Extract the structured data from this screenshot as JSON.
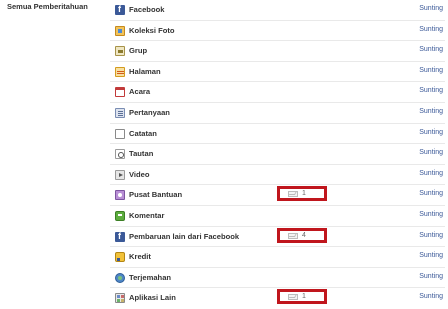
{
  "section_label": "Semua Pemberitahuan",
  "edit_label": "Sunting",
  "items": [
    {
      "label": "Facebook",
      "icon": "facebook-icon"
    },
    {
      "label": "Koleksi Foto",
      "icon": "photo-album-icon"
    },
    {
      "label": "Grup",
      "icon": "group-icon"
    },
    {
      "label": "Halaman",
      "icon": "page-flag-icon"
    },
    {
      "label": "Acara",
      "icon": "calendar-icon"
    },
    {
      "label": "Pertanyaan",
      "icon": "question-list-icon"
    },
    {
      "label": "Catatan",
      "icon": "note-icon"
    },
    {
      "label": "Tautan",
      "icon": "link-icon"
    },
    {
      "label": "Video",
      "icon": "video-camera-icon"
    },
    {
      "label": "Pusat Bantuan",
      "icon": "help-center-icon",
      "count": "1"
    },
    {
      "label": "Komentar",
      "icon": "comment-icon"
    },
    {
      "label": "Pembaruan lain dari Facebook",
      "icon": "facebook-icon",
      "count": "4"
    },
    {
      "label": "Kredit",
      "icon": "credits-icon"
    },
    {
      "label": "Terjemahan",
      "icon": "globe-icon"
    },
    {
      "label": "Aplikasi Lain",
      "icon": "apps-icon",
      "count": "1"
    }
  ]
}
